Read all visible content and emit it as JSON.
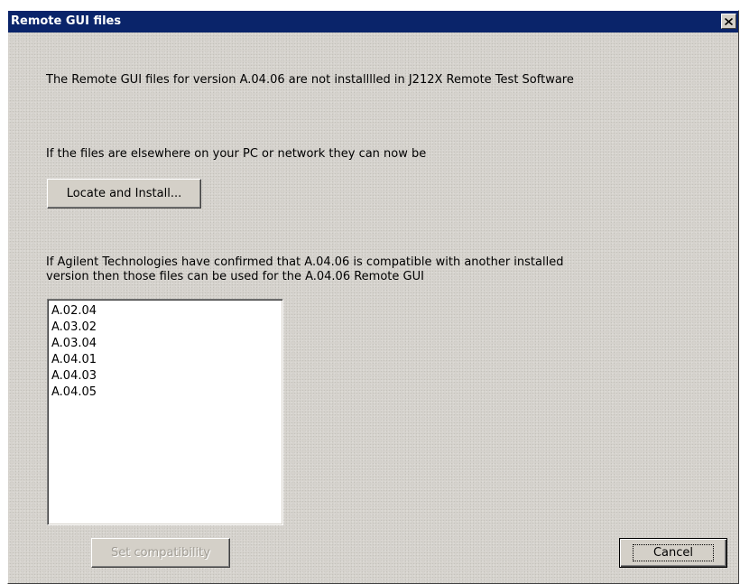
{
  "window": {
    "title": "Remote GUI files",
    "close_label": "Close"
  },
  "messages": {
    "not_installed": "The Remote GUI files for version A.04.06 are not installlled in J212X Remote Test Software",
    "elsewhere": "If the files are elsewhere on your PC or network they can now be",
    "compatible_line1": "If Agilent Technologies have confirmed that A.04.06 is compatible with another installed",
    "compatible_line2": "version then those files can be used for the A.04.06 Remote GUI"
  },
  "buttons": {
    "locate_install": "Locate and Install...",
    "set_compatibility": "Set compatibility",
    "cancel": "Cancel"
  },
  "versions_list": {
    "items": [
      "A.02.04",
      "A.03.02",
      "A.03.04",
      "A.04.01",
      "A.04.03",
      "A.04.05"
    ]
  },
  "colors": {
    "titlebar": "#0a246a",
    "dialog_bg": "#d6d3ce",
    "title_text": "#ffffff"
  },
  "icons": {
    "close": "close-icon"
  }
}
